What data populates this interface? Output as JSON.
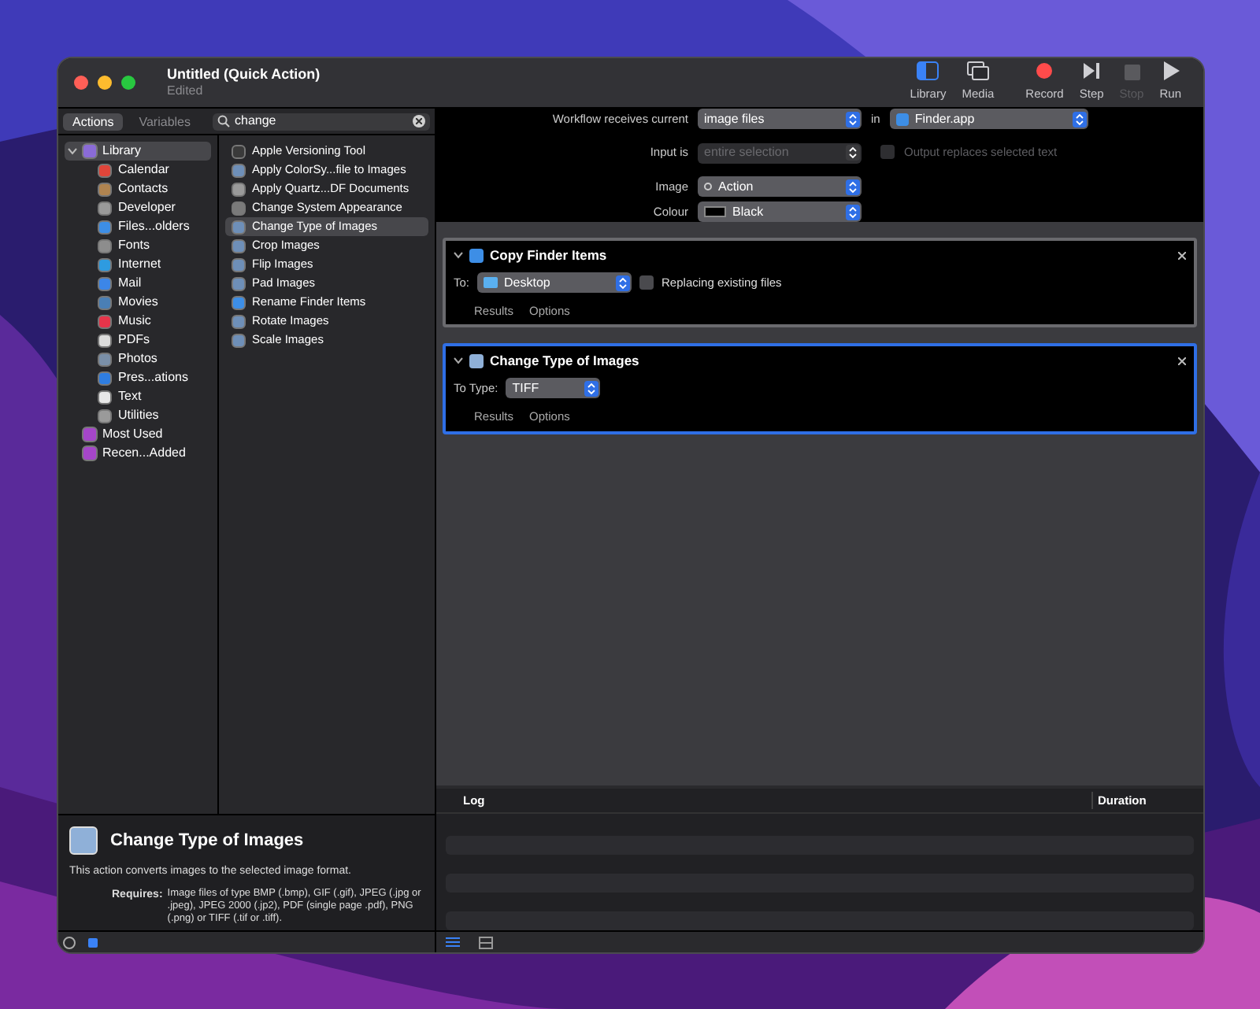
{
  "window": {
    "title": "Untitled (Quick Action)",
    "subtitle": "Edited"
  },
  "toolbar": [
    {
      "kind": "library",
      "label": "Library",
      "selected": true,
      "disabled": false
    },
    {
      "kind": "media",
      "label": "Media",
      "selected": false,
      "disabled": false
    },
    {
      "kind": "record",
      "label": "Record",
      "selected": false,
      "disabled": false
    },
    {
      "kind": "step",
      "label": "Step",
      "selected": false,
      "disabled": false
    },
    {
      "kind": "stop",
      "label": "Stop",
      "selected": false,
      "disabled": true
    },
    {
      "kind": "run",
      "label": "Run",
      "selected": false,
      "disabled": false
    }
  ],
  "tabs": [
    {
      "label": "Actions",
      "selected": true
    },
    {
      "label": "Variables",
      "selected": false
    }
  ],
  "search": {
    "value": "change"
  },
  "library": [
    {
      "label": "Library",
      "color": "#8a6bd6",
      "selected": true,
      "expanded": true,
      "children": [
        {
          "label": "Calendar",
          "color": "#e0453a"
        },
        {
          "label": "Contacts",
          "color": "#b08450"
        },
        {
          "label": "Developer",
          "color": "#9a9a9a"
        },
        {
          "label": "Files...olders",
          "color": "#3d8ee6"
        },
        {
          "label": "Fonts",
          "color": "#8d8d8d"
        },
        {
          "label": "Internet",
          "color": "#2e9be0"
        },
        {
          "label": "Mail",
          "color": "#3c86e8"
        },
        {
          "label": "Movies",
          "color": "#4a7fb5"
        },
        {
          "label": "Music",
          "color": "#e6344a"
        },
        {
          "label": "PDFs",
          "color": "#dcdcdc"
        },
        {
          "label": "Photos",
          "color": "#7a8fa8"
        },
        {
          "label": "Pres...ations",
          "color": "#2f7de0"
        },
        {
          "label": "Text",
          "color": "#e8e8e8"
        },
        {
          "label": "Utilities",
          "color": "#9a9a9a"
        }
      ]
    },
    {
      "label": "Most Used",
      "color": "#a546c9",
      "selected": false
    },
    {
      "label": "Recen...Added",
      "color": "#a546c9",
      "selected": false
    }
  ],
  "actions": [
    {
      "label": "Apple Versioning Tool",
      "color": "#3a3a3a",
      "selected": false
    },
    {
      "label": "Apply ColorSy...file to Images",
      "color": "#6e8fb8",
      "selected": false
    },
    {
      "label": "Apply Quartz...DF Documents",
      "color": "#9a9a9a",
      "selected": false
    },
    {
      "label": "Change System Appearance",
      "color": "#7a7a7a",
      "selected": false
    },
    {
      "label": "Change Type of Images",
      "color": "#6e8fb8",
      "selected": true
    },
    {
      "label": "Crop Images",
      "color": "#6e8fb8",
      "selected": false
    },
    {
      "label": "Flip Images",
      "color": "#6e8fb8",
      "selected": false
    },
    {
      "label": "Pad Images",
      "color": "#6e8fb8",
      "selected": false
    },
    {
      "label": "Rename Finder Items",
      "color": "#3d8ee6",
      "selected": false
    },
    {
      "label": "Rotate Images",
      "color": "#6e8fb8",
      "selected": false
    },
    {
      "label": "Scale Images",
      "color": "#6e8fb8",
      "selected": false
    }
  ],
  "description": {
    "title": "Change Type of Images",
    "text": "This action converts images to the selected image format.",
    "requires_label": "Requires:",
    "requires": "Image files of type BMP (.bmp), GIF (.gif), JPEG (.jpg or .jpeg), JPEG 2000 (.jp2), PDF (single page .pdf), PNG (.png) or TIFF (.tif or .tiff)."
  },
  "workflow": {
    "receives_label": "Workflow receives current",
    "receives": "image files",
    "in_label": "in",
    "app": "Finder.app",
    "input_label": "Input is",
    "input": "entire selection",
    "input_disabled": true,
    "output_replaces": {
      "label": "Output replaces selected text",
      "checked": false,
      "disabled": true
    },
    "image_label": "Image",
    "image": "Action",
    "colour_label": "Colour",
    "colour": "Black"
  },
  "workflow_actions": [
    {
      "title": "Copy Finder Items",
      "selected": false,
      "field_label": "To:",
      "field_value": "Desktop",
      "checkbox": {
        "label": "Replacing existing files",
        "checked": false
      },
      "tabs": [
        "Results",
        "Options"
      ]
    },
    {
      "title": "Change Type of Images",
      "selected": true,
      "field_label": "To Type:",
      "field_value": "TIFF",
      "tabs": [
        "Results",
        "Options"
      ]
    }
  ],
  "log": {
    "columns": [
      "Log",
      "Duration"
    ]
  }
}
